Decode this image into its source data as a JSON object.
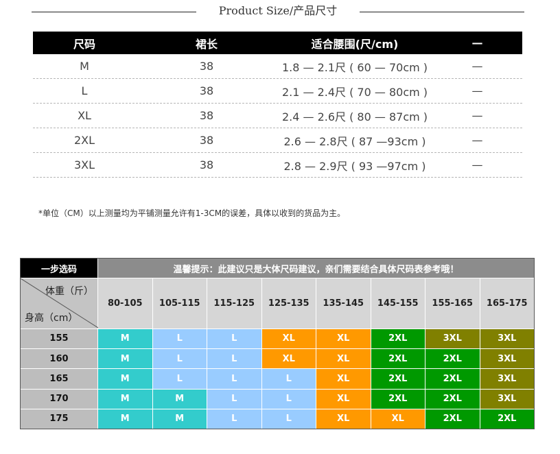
{
  "header": {
    "title": "Product Size/产品尺寸"
  },
  "size_table": {
    "headers": [
      "尺码",
      "裙长",
      "适合腰围(尺/cm)",
      "—"
    ],
    "rows": [
      [
        "M",
        "38",
        "1.8 — 2.1尺 ( 60 — 70cm )",
        "—"
      ],
      [
        "L",
        "38",
        "2.1 — 2.4尺 ( 70 — 80cm )",
        "—"
      ],
      [
        "XL",
        "38",
        "2.4 — 2.6尺 ( 80 — 87cm )",
        "—"
      ],
      [
        "2XL",
        "38",
        "2.6 — 2.8尺 ( 87 —93cm )",
        "—"
      ],
      [
        "3XL",
        "38",
        "2.8 — 2.9尺 ( 93 —97cm )",
        "—"
      ]
    ]
  },
  "note": "*单位（CM）以上测量均为平铺测量允许有1-3CM的误差，具体以收到的货品为主。",
  "recommend": {
    "step_label": "一步选码",
    "tip": "温馨提示：此建议只是大体尺码建议，亲们需要结合具体尺码表参考哦！",
    "weight_label": "体重（斤）",
    "height_label": "身高（cm）",
    "weights": [
      "80-105",
      "105-115",
      "115-125",
      "125-135",
      "135-145",
      "145-155",
      "155-165",
      "165-175"
    ],
    "heights": [
      "155",
      "160",
      "165",
      "170",
      "175"
    ],
    "sizes": [
      [
        "M",
        "L",
        "L",
        "XL",
        "XL",
        "2XL",
        "3XL",
        "3XL"
      ],
      [
        "M",
        "L",
        "L",
        "XL",
        "XL",
        "2XL",
        "2XL",
        "3XL"
      ],
      [
        "M",
        "L",
        "L",
        "L",
        "XL",
        "2XL",
        "2XL",
        "3XL"
      ],
      [
        "M",
        "M",
        "L",
        "L",
        "XL",
        "2XL",
        "2XL",
        "3XL"
      ],
      [
        "M",
        "M",
        "L",
        "L",
        "XL",
        "XL",
        "2XL",
        "2XL"
      ]
    ],
    "colors": {
      "M": "#33cccc",
      "L": "#99ccff",
      "XL": "#ff9900",
      "2XL": "#009900",
      "3XL": "#808000"
    }
  }
}
